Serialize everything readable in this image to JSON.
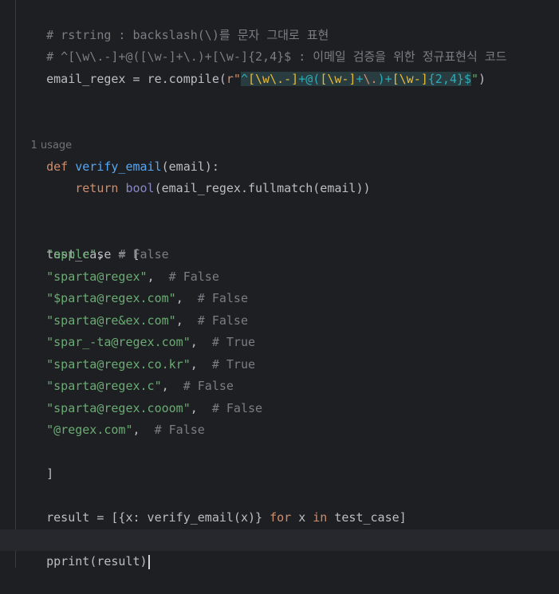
{
  "editor": {
    "comment_line1": "# rstring : backslash(\\)를 문자 그대로 표현",
    "comment_line2": "# ^[\\w\\.-]+@([\\w-]+\\.)+[\\w-]{2,4}$ : 이메일 검증을 위한 정규표현식 코드",
    "regex_line": {
      "var": "email_regex",
      "op": " = ",
      "call": "re.compile(",
      "prefix": "r\"",
      "p1": "^",
      "p2": "[\\w\\.-]",
      "p3": "+@(",
      "p4": "[\\w-]",
      "p5": "+",
      "p6": "\\.",
      "p7": ")+",
      "p8": "[\\w-]",
      "p9": "{2,4}",
      "p10": "$",
      "quote": "\"",
      "close": ")"
    },
    "usage_hint": "1 usage",
    "def_line": {
      "kw": "def",
      "name": "verify_email",
      "params": "(email):"
    },
    "return_line": {
      "kw": "return",
      "builtin": "bool",
      "rest": "(email_regex.fullmatch(email))"
    },
    "test_case_open": "test_case = [",
    "test_cases": [
      {
        "str": "\"apple\"",
        "sep": ",  ",
        "comment": "# False"
      },
      {
        "str": "\"sparta@regex\"",
        "sep": ",  ",
        "comment": "# False"
      },
      {
        "str": "\"$parta@regex.com\"",
        "sep": ",  ",
        "comment": "# False"
      },
      {
        "str": "\"sparta@re&ex.com\"",
        "sep": ",  ",
        "comment": "# False"
      },
      {
        "str": "\"spar_-ta@regex.com\"",
        "sep": ",  ",
        "comment": "# True"
      },
      {
        "str": "\"sparta@regex.co.kr\"",
        "sep": ",  ",
        "comment": "# True"
      },
      {
        "str": "\"sparta@regex.c\"",
        "sep": ",  ",
        "comment": "# False"
      },
      {
        "str": "\"sparta@regex.cooom\"",
        "sep": ",  ",
        "comment": "# False"
      },
      {
        "str": "\"@regex.com\"",
        "sep": ",  ",
        "comment": "# False"
      }
    ],
    "test_case_close": "]",
    "result_line": {
      "a": "result = [{x: verify_email(x)} ",
      "kw_for": "for",
      "b": " x ",
      "kw_in": "in",
      "c": " test_case]"
    },
    "pprint_line": {
      "fn": "pprint",
      "args": "(result)"
    }
  }
}
